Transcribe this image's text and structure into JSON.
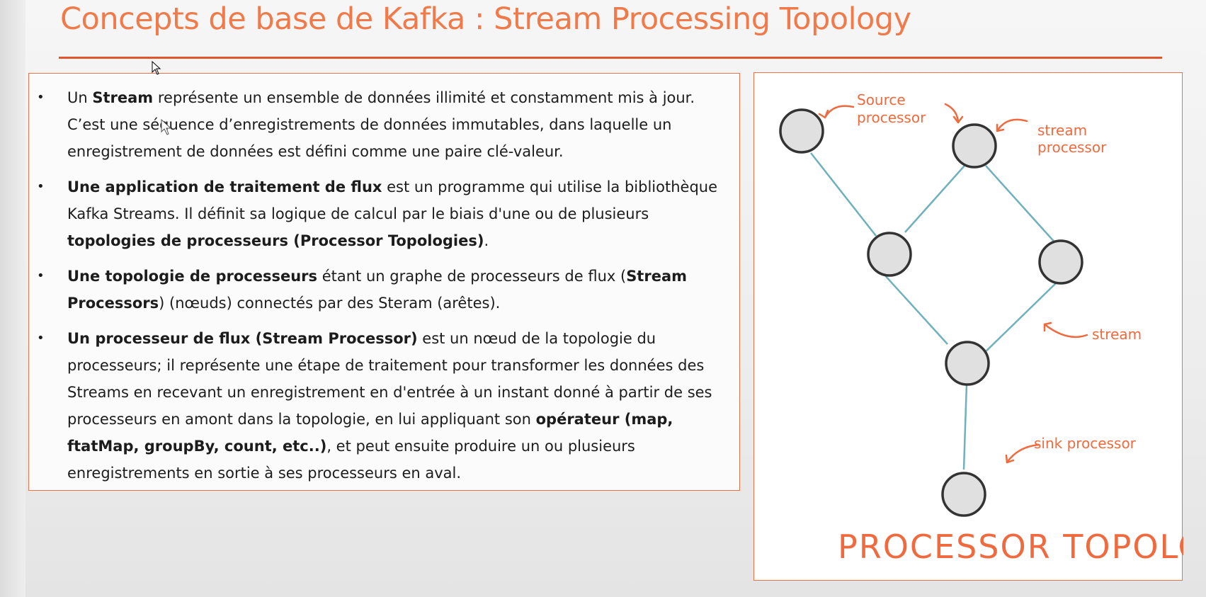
{
  "slide": {
    "title": "Concepts de base de Kafka : Stream Processing Topology",
    "accent_color": "#e2542a"
  },
  "bullets": [
    [
      {
        "t": "Un ",
        "b": false
      },
      {
        "t": "Stream",
        "b": true
      },
      {
        "t": " représente un ensemble de données illimité et constamment mis à jour. C’est une séquence d’enregistrements de données immutables, dans laquelle un enregistrement de données est défini comme une paire clé-valeur.",
        "b": false
      }
    ],
    [
      {
        "t": "Une application de traitement de flux",
        "b": true
      },
      {
        "t": " est un programme qui utilise la bibliothèque Kafka Streams. Il définit sa logique de calcul par le biais d'une ou de plusieurs ",
        "b": false
      },
      {
        "t": "topologies de processeurs (Processor Topologies)",
        "b": true
      },
      {
        "t": ".",
        "b": false
      }
    ],
    [
      {
        "t": "Une topologie de processeurs",
        "b": true
      },
      {
        "t": " étant un graphe de processeurs de flux (",
        "b": false
      },
      {
        "t": "Stream Processors",
        "b": true
      },
      {
        "t": ") (nœuds) connectés par des Steram (arêtes).",
        "b": false
      }
    ],
    [
      {
        "t": "Un processeur de flux (Stream Processor)",
        "b": true
      },
      {
        "t": " est un nœud de la topologie du processeurs; il représente une étape de traitement pour transformer les données des Streams en recevant un enregistrement en d'entrée à un instant donné à partir de ses processeurs en amont dans la topologie, en lui appliquant son ",
        "b": false
      },
      {
        "t": "opérateur (map, ftatMap, groupBy, count, etc..)",
        "b": true
      },
      {
        "t": ", et peut ensuite produire un ou plusieurs enregistrements en sortie à ses processeurs en aval.",
        "b": false
      }
    ]
  ],
  "diagram": {
    "labels": {
      "source_line1": "Source",
      "source_line2": "processor",
      "stream_proc_line1": "stream",
      "stream_proc_line2": "processor",
      "stream": "stream",
      "sink": "sink processor",
      "caption": "PROCESSOR TOPOLOGY"
    },
    "colors": {
      "node_fill": "#e0e0e0",
      "node_stroke": "#333333",
      "edge": "#6fb0bd",
      "annotation": "#ef6a3e"
    }
  }
}
